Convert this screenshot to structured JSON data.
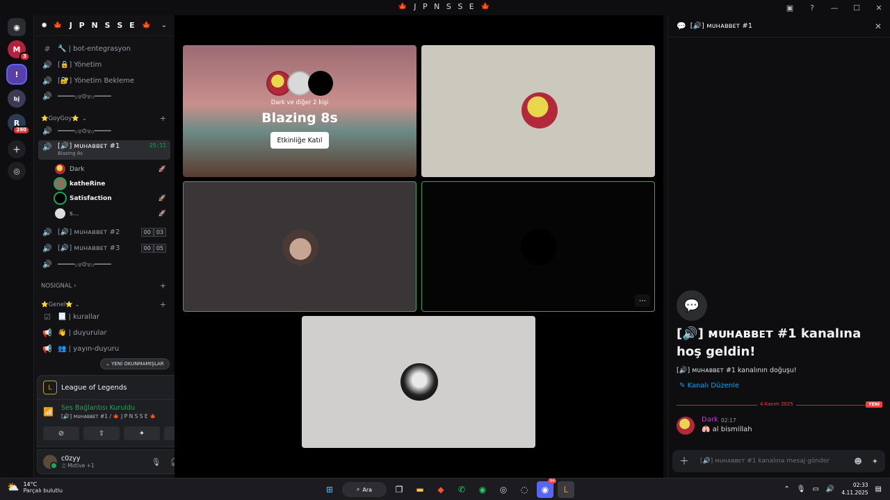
{
  "window": {
    "title": "🍁 J P N S S E 🍁",
    "title_text": "J P N S S E"
  },
  "guilds": [
    {
      "label": "M",
      "badge": "3"
    },
    {
      "label": "!",
      "badge": ""
    },
    {
      "label": "bj",
      "badge": ""
    },
    {
      "label": "R",
      "badge": "280"
    }
  ],
  "server": {
    "name": "J P N S S E"
  },
  "channels": [
    {
      "icon": "#",
      "label": "🔧 | bot-entegrasyon"
    },
    {
      "icon": "🔊",
      "label": "[🔒] Yönetim"
    },
    {
      "icon": "🔊",
      "label": "[🔐] Yönetim Bekleme"
    },
    {
      "icon": "🔊",
      "label": "━━━━━۞۩⏣۩۞━━━━━"
    }
  ],
  "cat_goygoy": {
    "label": "⭐GoyGoy⭐",
    "chev": "⌄"
  },
  "goygoy_sep": {
    "label": "━━━━━۞۩⏣۩۞━━━━━"
  },
  "active_channel": {
    "label": "[🔊] ᴍᴜʜᴀʙʙᴇᴛ #1",
    "sub": "Blazing 8s",
    "time": "25:11"
  },
  "voice_users": [
    {
      "name": "Dark"
    },
    {
      "name": "katheRine"
    },
    {
      "name": "Satisfaction"
    },
    {
      "name": "s..."
    }
  ],
  "muh2": {
    "label": "[🔊] ᴍᴜʜᴀʙʙᴇᴛ #2",
    "a": "00",
    "b": "03"
  },
  "muh3": {
    "label": "[🔊] ᴍᴜʜᴀʙʙᴇᴛ #3",
    "a": "00",
    "b": "05"
  },
  "sep2": {
    "label": "━━━━━۞۩⏣۩۞━━━━━"
  },
  "cat_nosignal": {
    "label": "NOSIGNAL ›"
  },
  "cat_genel": {
    "label": "⭐Genel⭐ ⌄"
  },
  "genel_channels": [
    {
      "label": "📃 | kurallar"
    },
    {
      "label": "👋 | duyurular"
    },
    {
      "label": "👥 | yayın-duyuru"
    }
  ],
  "new_unread": "⌄ YENİ OKUNMAMIŞLAR",
  "game": {
    "name": "League of Legends"
  },
  "voice": {
    "status": "Ses Bağlantısı Kuruldu",
    "where": "[🔊] ᴍᴜʜᴀʙʙᴇᴛ #1 / 🍁 J P N S S E 🍁"
  },
  "account": {
    "name": "c0zyy",
    "status": "♫ Motive +1"
  },
  "activity": {
    "subtitle": "Dark ve diğer 2 kişi",
    "title": "Blazing 8s",
    "button": "Etkinliğe Katıl"
  },
  "chat": {
    "header": "[🔊] ᴍᴜʜᴀʙʙᴇᴛ #1",
    "welcome_title": "[🔊] ᴍᴜʜᴀʙʙᴇᴛ #1 kanalına hoş geldin!",
    "welcome_sub": "[🔊] ᴍᴜʜᴀʙʙᴇᴛ #1 kanalının doğuşu!",
    "edit": "Kanalı Düzenle",
    "date": "4 Kasım 2025",
    "new": "YENİ",
    "msg_author": "Dark",
    "msg_time": "02:17",
    "msg_text": "🫁 al bismillah",
    "placeholder": "[🔊] ᴍᴜʜᴀʙʙᴇᴛ #1 kanalına mesaj gönder"
  },
  "taskbar": {
    "temp": "14°C",
    "weather": "Parçalı bulutlu",
    "search": "Ara",
    "time": "02:33",
    "date": "4.11.2025",
    "discord_badge": "94"
  }
}
